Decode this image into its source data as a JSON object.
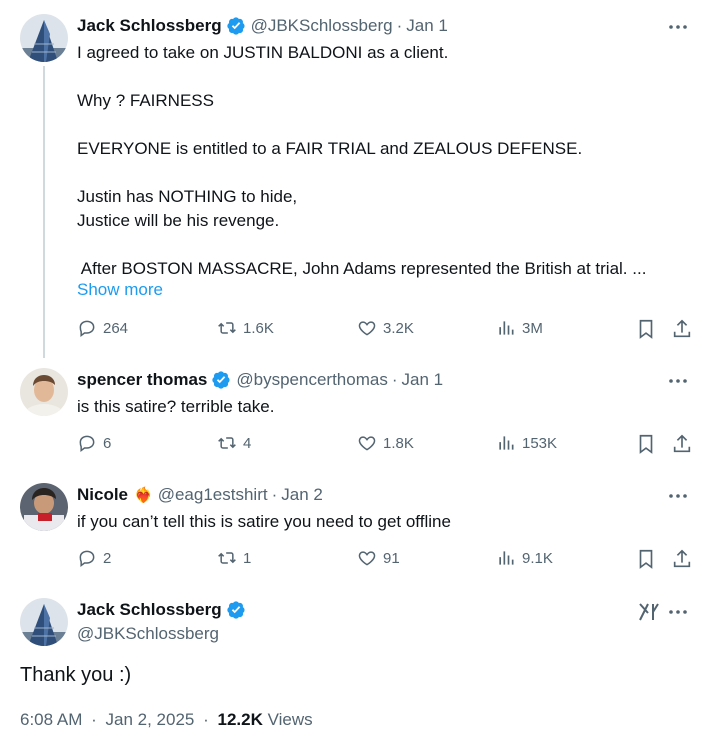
{
  "tweets": [
    {
      "name": "Jack Schlossberg",
      "handle": "@JBKSchlossberg",
      "date": "Jan 1",
      "lines": [
        "I agreed to take on JUSTIN BALDONI as a client.",
        "",
        "Why ? FAIRNESS",
        "",
        "EVERYONE is entitled to a FAIR TRIAL and ZEALOUS DEFENSE.",
        "",
        "Justin has NOTHING to hide,",
        "Justice will be his revenge.",
        "",
        " After BOSTON MASSACRE, John Adams represented the British at trial. ..."
      ],
      "show_more": "Show more",
      "replies": "264",
      "reposts": "1.6K",
      "likes": "3.2K",
      "views": "3M"
    },
    {
      "name": "spencer thomas",
      "handle": "@byspencerthomas",
      "date": "Jan 1",
      "text": "is this satire? terrible take.",
      "replies": "6",
      "reposts": "4",
      "likes": "1.8K",
      "views": "153K"
    },
    {
      "name": "Nicole",
      "name_emoji": "❤️‍🔥",
      "handle": "@eag1estshirt",
      "date": "Jan 2",
      "text": "if you can’t tell this is satire you need to get offline",
      "replies": "2",
      "reposts": "1",
      "likes": "91",
      "views": "9.1K"
    }
  ],
  "focus": {
    "name": "Jack Schlossberg",
    "handle": "@JBKSchlossberg",
    "text": "Thank you :)",
    "time": "6:08 AM",
    "date": "Jan 2, 2025",
    "views_count": "12.2K",
    "views_label": "Views"
  },
  "separator": "·",
  "colors": {
    "accent": "#1d9bf0",
    "secondary_text": "#536471",
    "thread_line": "#cfd9de"
  },
  "icons": [
    "reply-icon",
    "repost-icon",
    "like-icon",
    "views-icon",
    "bookmark-icon",
    "share-icon",
    "more-icon",
    "verified-badge-icon",
    "grok-icon"
  ]
}
